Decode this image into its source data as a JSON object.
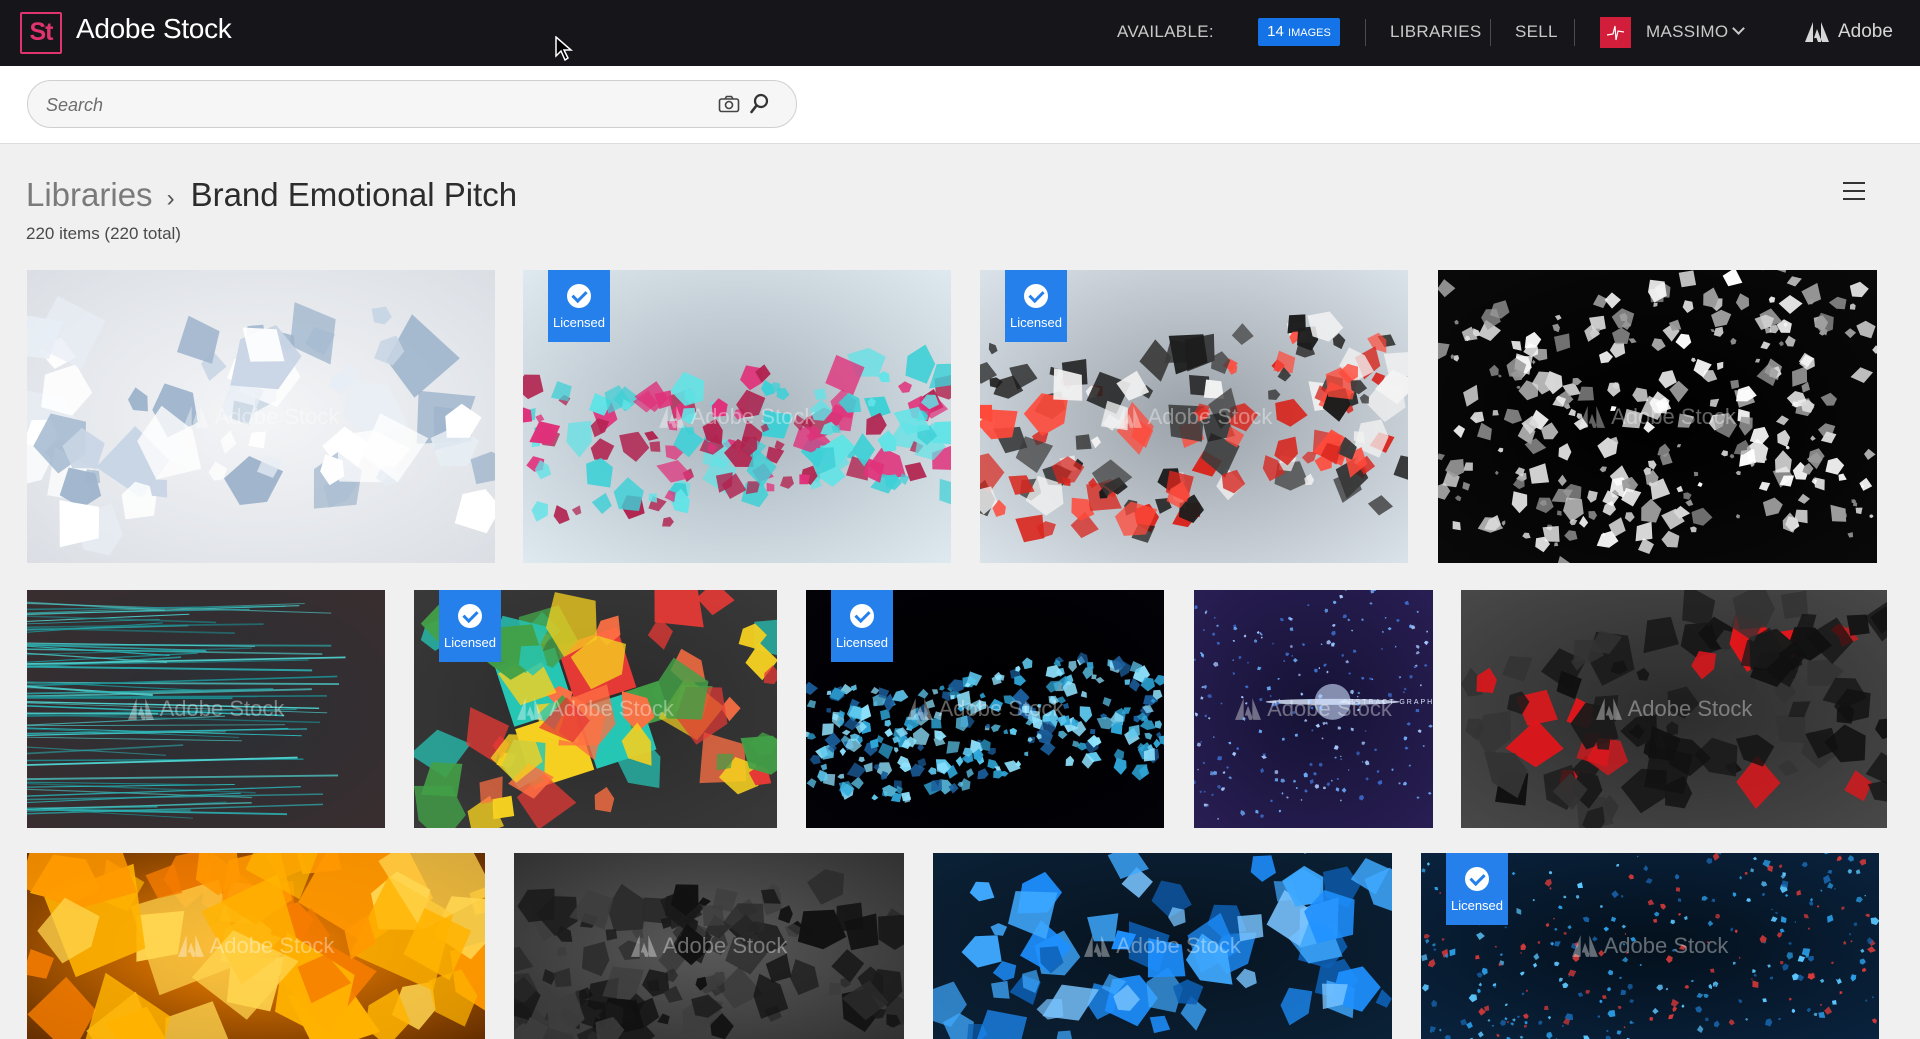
{
  "app": {
    "logo_text": "St",
    "title": "Adobe Stock"
  },
  "nav": {
    "available_label": "AVAILABLE:",
    "images_count": "14",
    "images_unit": "IMAGES",
    "libraries": "LIBRARIES",
    "sell": "SELL",
    "user_name": "MASSIMO",
    "adobe": "Adobe"
  },
  "search": {
    "placeholder": "Search",
    "value": ""
  },
  "breadcrumb": {
    "root": "Libraries",
    "separator": "›",
    "current": "Brand Emotional Pitch"
  },
  "item_count": "220 items (220 total)",
  "watermark_text": "Adobe Stock",
  "licensed_label": "Licensed",
  "images": [
    {
      "id": "tile-1",
      "theme": "white-crystals",
      "licensed": false
    },
    {
      "id": "tile-2",
      "theme": "cyan-pink-cubes",
      "licensed": true
    },
    {
      "id": "tile-3",
      "theme": "red-black-cubes",
      "licensed": true
    },
    {
      "id": "tile-4",
      "theme": "white-shards",
      "licensed": false
    },
    {
      "id": "tile-5",
      "theme": "teal-particles",
      "licensed": false
    },
    {
      "id": "tile-6",
      "theme": "colorful-cube",
      "licensed": true
    },
    {
      "id": "tile-7",
      "theme": "blue-pixel-wave",
      "licensed": true
    },
    {
      "id": "tile-8",
      "theme": "abstract-graphics",
      "licensed": false,
      "inner_text": "ABSTRACT GRAPHICS"
    },
    {
      "id": "tile-9",
      "theme": "red-dark-shards",
      "licensed": false
    },
    {
      "id": "tile-10",
      "theme": "orange-cubes",
      "licensed": false
    },
    {
      "id": "tile-11",
      "theme": "dark-cubes",
      "licensed": false
    },
    {
      "id": "tile-12",
      "theme": "blue-polyhedra",
      "licensed": false
    },
    {
      "id": "tile-13",
      "theme": "blue-particles",
      "licensed": true
    }
  ],
  "colors": {
    "topbar": "#16161a",
    "accent": "#1473e6",
    "brand": "#e0346e",
    "licensed": "#2680eb"
  }
}
